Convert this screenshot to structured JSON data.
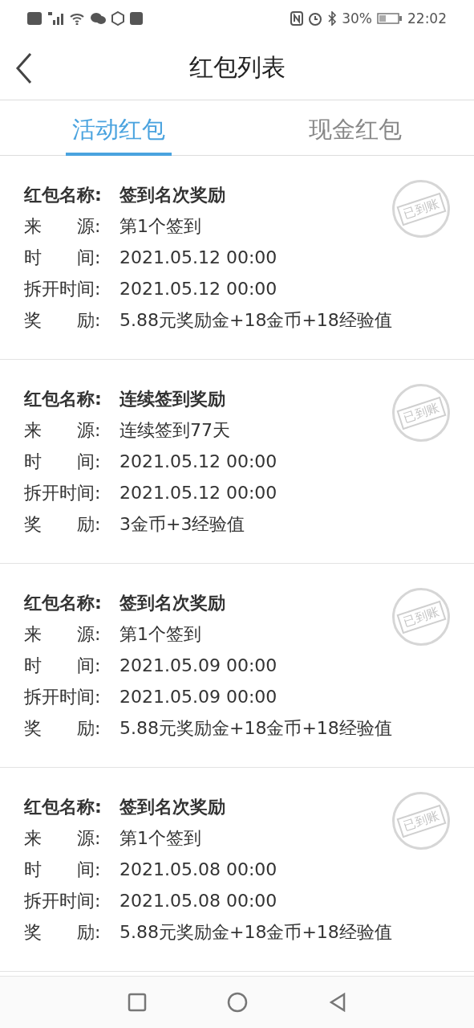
{
  "status_bar": {
    "battery": "30%",
    "time": "22:02"
  },
  "header": {
    "title": "红包列表"
  },
  "tabs": [
    {
      "label": "活动红包",
      "selected": true
    },
    {
      "label": "现金红包",
      "selected": false
    }
  ],
  "packets": [
    {
      "stamp": "已到账",
      "fields": [
        {
          "kind": "title",
          "label": "红包名称:",
          "value": "签到名次奖励"
        },
        {
          "kind": "detail",
          "label": "来　　源:",
          "value": "第1个签到"
        },
        {
          "kind": "detail",
          "label": "时　　间:",
          "value": "2021.05.12 00:00"
        },
        {
          "kind": "detail",
          "label": "拆开时间:",
          "value": "2021.05.12 00:00"
        },
        {
          "kind": "detail",
          "label": "奖　　励:",
          "value": "5.88元奖励金+18金币+18经验值"
        }
      ]
    },
    {
      "stamp": "已到账",
      "fields": [
        {
          "kind": "title",
          "label": "红包名称:",
          "value": "连续签到奖励"
        },
        {
          "kind": "detail",
          "label": "来　　源:",
          "value": "连续签到77天"
        },
        {
          "kind": "detail",
          "label": "时　　间:",
          "value": "2021.05.12 00:00"
        },
        {
          "kind": "detail",
          "label": "拆开时间:",
          "value": "2021.05.12 00:00"
        },
        {
          "kind": "detail",
          "label": "奖　　励:",
          "value": "3金币+3经验值"
        }
      ]
    },
    {
      "stamp": "已到账",
      "fields": [
        {
          "kind": "title",
          "label": "红包名称:",
          "value": "签到名次奖励"
        },
        {
          "kind": "detail",
          "label": "来　　源:",
          "value": "第1个签到"
        },
        {
          "kind": "detail",
          "label": "时　　间:",
          "value": "2021.05.09 00:00"
        },
        {
          "kind": "detail",
          "label": "拆开时间:",
          "value": "2021.05.09 00:00"
        },
        {
          "kind": "detail",
          "label": "奖　　励:",
          "value": "5.88元奖励金+18金币+18经验值"
        }
      ]
    },
    {
      "stamp": "已到账",
      "fields": [
        {
          "kind": "title",
          "label": "红包名称:",
          "value": "签到名次奖励"
        },
        {
          "kind": "detail",
          "label": "来　　源:",
          "value": "第1个签到"
        },
        {
          "kind": "detail",
          "label": "时　　间:",
          "value": "2021.05.08 00:00"
        },
        {
          "kind": "detail",
          "label": "拆开时间:",
          "value": "2021.05.08 00:00"
        },
        {
          "kind": "detail",
          "label": "奖　　励:",
          "value": "5.88元奖励金+18金币+18经验值"
        }
      ]
    }
  ]
}
